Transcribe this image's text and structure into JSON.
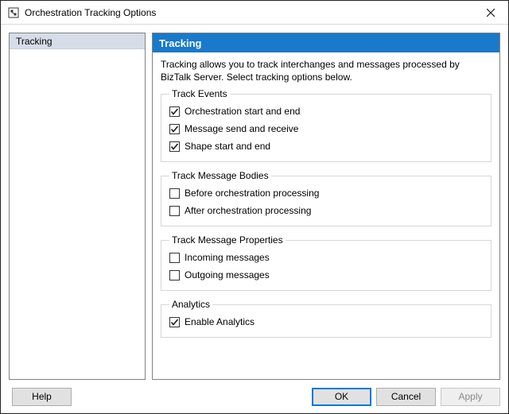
{
  "window": {
    "title": "Orchestration Tracking Options"
  },
  "sidebar": {
    "items": [
      {
        "label": "Tracking"
      }
    ]
  },
  "content": {
    "header": "Tracking",
    "description": "Tracking allows you to track interchanges and messages processed by BizTalk Server. Select tracking options below.",
    "groups": [
      {
        "legend": "Track Events",
        "options": [
          {
            "label": "Orchestration start and end",
            "checked": true
          },
          {
            "label": "Message send and receive",
            "checked": true
          },
          {
            "label": "Shape start and end",
            "checked": true
          }
        ]
      },
      {
        "legend": "Track Message Bodies",
        "options": [
          {
            "label": "Before orchestration processing",
            "checked": false
          },
          {
            "label": "After orchestration processing",
            "checked": false
          }
        ]
      },
      {
        "legend": "Track Message Properties",
        "options": [
          {
            "label": "Incoming messages",
            "checked": false
          },
          {
            "label": "Outgoing messages",
            "checked": false
          }
        ]
      },
      {
        "legend": "Analytics",
        "options": [
          {
            "label": "Enable Analytics",
            "checked": true
          }
        ]
      }
    ]
  },
  "footer": {
    "help": "Help",
    "ok": "OK",
    "cancel": "Cancel",
    "apply": "Apply"
  }
}
